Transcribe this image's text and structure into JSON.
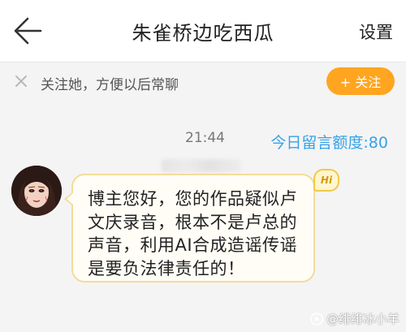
{
  "header": {
    "back_icon": "arrow-left-icon",
    "title": "朱雀桥边吃西瓜",
    "settings_label": "设置"
  },
  "follow_prompt": {
    "close_icon": "close-icon",
    "text": "关注她，方便以后常聊",
    "button_label": "+ 关注",
    "button_color": "#ffa51f"
  },
  "chat": {
    "timestamp": "21:44",
    "quota_text": "今日留言额度:80",
    "quota_color": "#35a2e8",
    "message": {
      "avatar_icon": "avatar-woman-icon",
      "text": "博主您好，您的作品疑似卢文庆录音，根本不是卢总的声音，利用AI合成造谣传谣是要负法律责任的！",
      "badge": "Hi"
    }
  },
  "watermark": {
    "text": "@绯绯冰小羊"
  }
}
